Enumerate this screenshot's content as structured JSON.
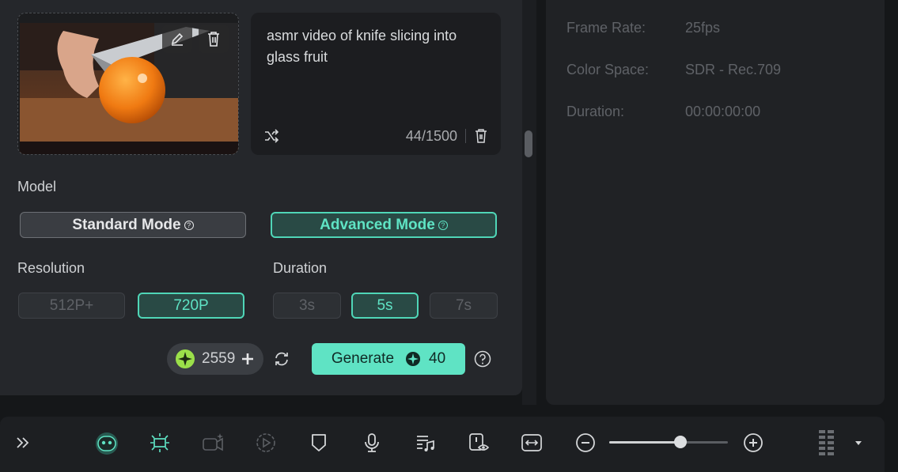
{
  "prompt": {
    "text": "asmr video of knife slicing into glass fruit",
    "count": "44/1500"
  },
  "model": {
    "label": "Model",
    "standard": "Standard Mode",
    "advanced": "Advanced Mode",
    "selected": "Advanced Mode"
  },
  "resolution": {
    "label": "Resolution",
    "options": [
      "512P+",
      "720P"
    ],
    "selected": "720P"
  },
  "duration": {
    "label": "Duration",
    "options": [
      "3s",
      "5s",
      "7s"
    ],
    "selected": "5s"
  },
  "credits": {
    "balance": "2559"
  },
  "generate": {
    "label": "Generate",
    "cost": "40"
  },
  "info": {
    "rows": [
      {
        "label": "Frame Rate:",
        "value": "25fps"
      },
      {
        "label": "Color Space:",
        "value": "SDR - Rec.709"
      },
      {
        "label": "Duration:",
        "value": "00:00:00:00"
      }
    ]
  },
  "toolbar": {
    "zoom_level": 0.6,
    "icons": [
      "expand-chevrons-icon",
      "ai-robot-icon",
      "auto-reframe-icon",
      "ai-video-icon",
      "play-circle-icon",
      "marker-shield-icon",
      "microphone-icon",
      "music-list-icon",
      "preview-eye-icon",
      "fit-width-icon",
      "zoom-out-icon",
      "zoom-in-icon",
      "grid-layout-icon",
      "dropdown-arrow-icon"
    ]
  },
  "colors": {
    "accent": "#5fe3c4",
    "panel": "#25272b",
    "background": "#151719"
  }
}
